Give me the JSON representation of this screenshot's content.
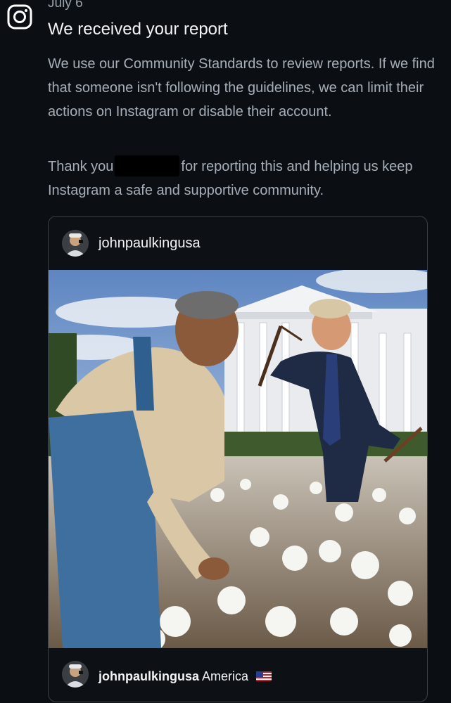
{
  "notification": {
    "date": "July 6",
    "title": "We received your report",
    "paragraph1": "We use our Community Standards to review reports. If we find that someone isn't following the guidelines, we can limit their actions on Instagram or disable their account.",
    "paragraph2_prefix": "Thank you",
    "paragraph2_suffix": "for reporting this and helping us keep Instagram a safe and supportive community."
  },
  "post": {
    "username": "johnpaulkingusa",
    "caption_user": "johnpaulkingusa",
    "caption_text": " America "
  },
  "icons": {
    "app": "instagram-icon",
    "flag": "us-flag-icon"
  },
  "colors": {
    "background": "#0b0f14",
    "text_primary": "#f2f4f6",
    "text_secondary": "#a6aeb7",
    "card_border": "#3a4048"
  }
}
